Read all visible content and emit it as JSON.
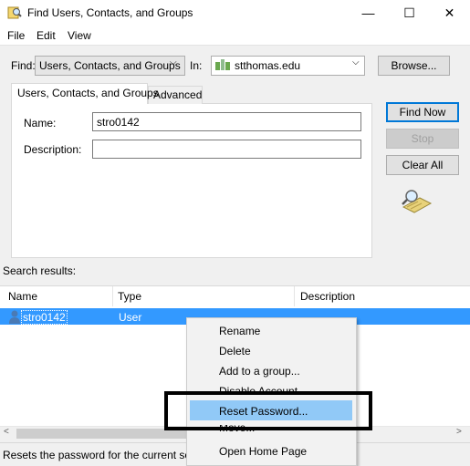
{
  "window": {
    "title": "Find Users, Contacts, and Groups",
    "controls": {
      "minimize": "—",
      "maximize": "☐",
      "close": "✕"
    }
  },
  "menu": {
    "file": "File",
    "edit": "Edit",
    "view": "View"
  },
  "search": {
    "find_label": "Find:",
    "find_value": "Users, Contacts, and Groups",
    "in_label": "In:",
    "in_value": "stthomas.edu",
    "browse_label": "Browse..."
  },
  "tabs": [
    {
      "label": "Users, Contacts, and Groups",
      "active": true
    },
    {
      "label": "Advanced",
      "active": false
    }
  ],
  "form": {
    "name_label": "Name:",
    "name_value": "stro0142",
    "description_label": "Description:",
    "description_value": ""
  },
  "actions": {
    "find_now": "Find Now",
    "stop": "Stop",
    "clear_all": "Clear All"
  },
  "results": {
    "label": "Search results:",
    "columns": [
      "Name",
      "Type",
      "Description"
    ],
    "rows": [
      {
        "name": "stro0142",
        "type": "User",
        "description": ""
      }
    ]
  },
  "context_menu": {
    "items": [
      "Rename",
      "Delete",
      "Add to a group...",
      "Disable Account",
      "Reset Password...",
      "Move...",
      "Open Home Page"
    ],
    "highlighted": "Reset Password..."
  },
  "status": {
    "text": "Resets the password for the current selection."
  },
  "colors": {
    "selection": "#3399ff",
    "menu_highlight": "#91c9f7",
    "default_button_border": "#0078d7"
  },
  "icons": {
    "app": "find-people-icon",
    "domain": "domain-icon",
    "user": "user-icon",
    "search_anim": "magnifier-icon"
  }
}
